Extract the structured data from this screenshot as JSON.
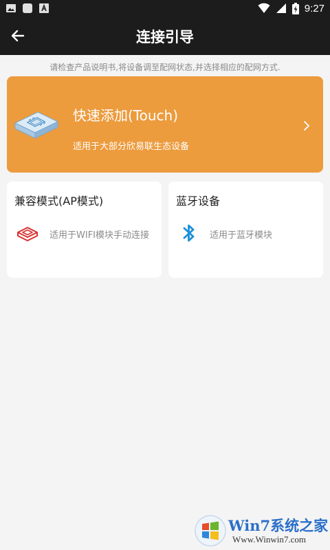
{
  "status_bar": {
    "time": "9:27",
    "left_icons": [
      "image-notification-icon",
      "app-notification-icon",
      "text-notification-icon"
    ],
    "right_icons": [
      "wifi-icon",
      "signal-icon",
      "battery-charging-icon"
    ]
  },
  "header": {
    "title": "连接引导",
    "back_icon": "arrow-left-icon"
  },
  "hint": "请检查产品说明书,将设备调至配网状态,并选择相应的配网方式.",
  "quick_add": {
    "title": "快速添加(Touch)",
    "subtitle": "适用于大部分欣易联生态设备",
    "icon": "device-chip-icon",
    "chevron": "chevron-right-icon",
    "background_color": "#ec9b3d"
  },
  "options": [
    {
      "title": "兼容模式(AP模式)",
      "subtitle": "适用于WIFI模块手动连接",
      "icon": "ap-module-icon",
      "icon_color": "#d9312f"
    },
    {
      "title": "蓝牙设备",
      "subtitle": "适用于蓝牙模块",
      "icon": "bluetooth-icon",
      "icon_color": "#1a8fd8"
    }
  ],
  "watermark": {
    "brand": "Win7系统之家",
    "url": "Www.Winwin7.com"
  }
}
